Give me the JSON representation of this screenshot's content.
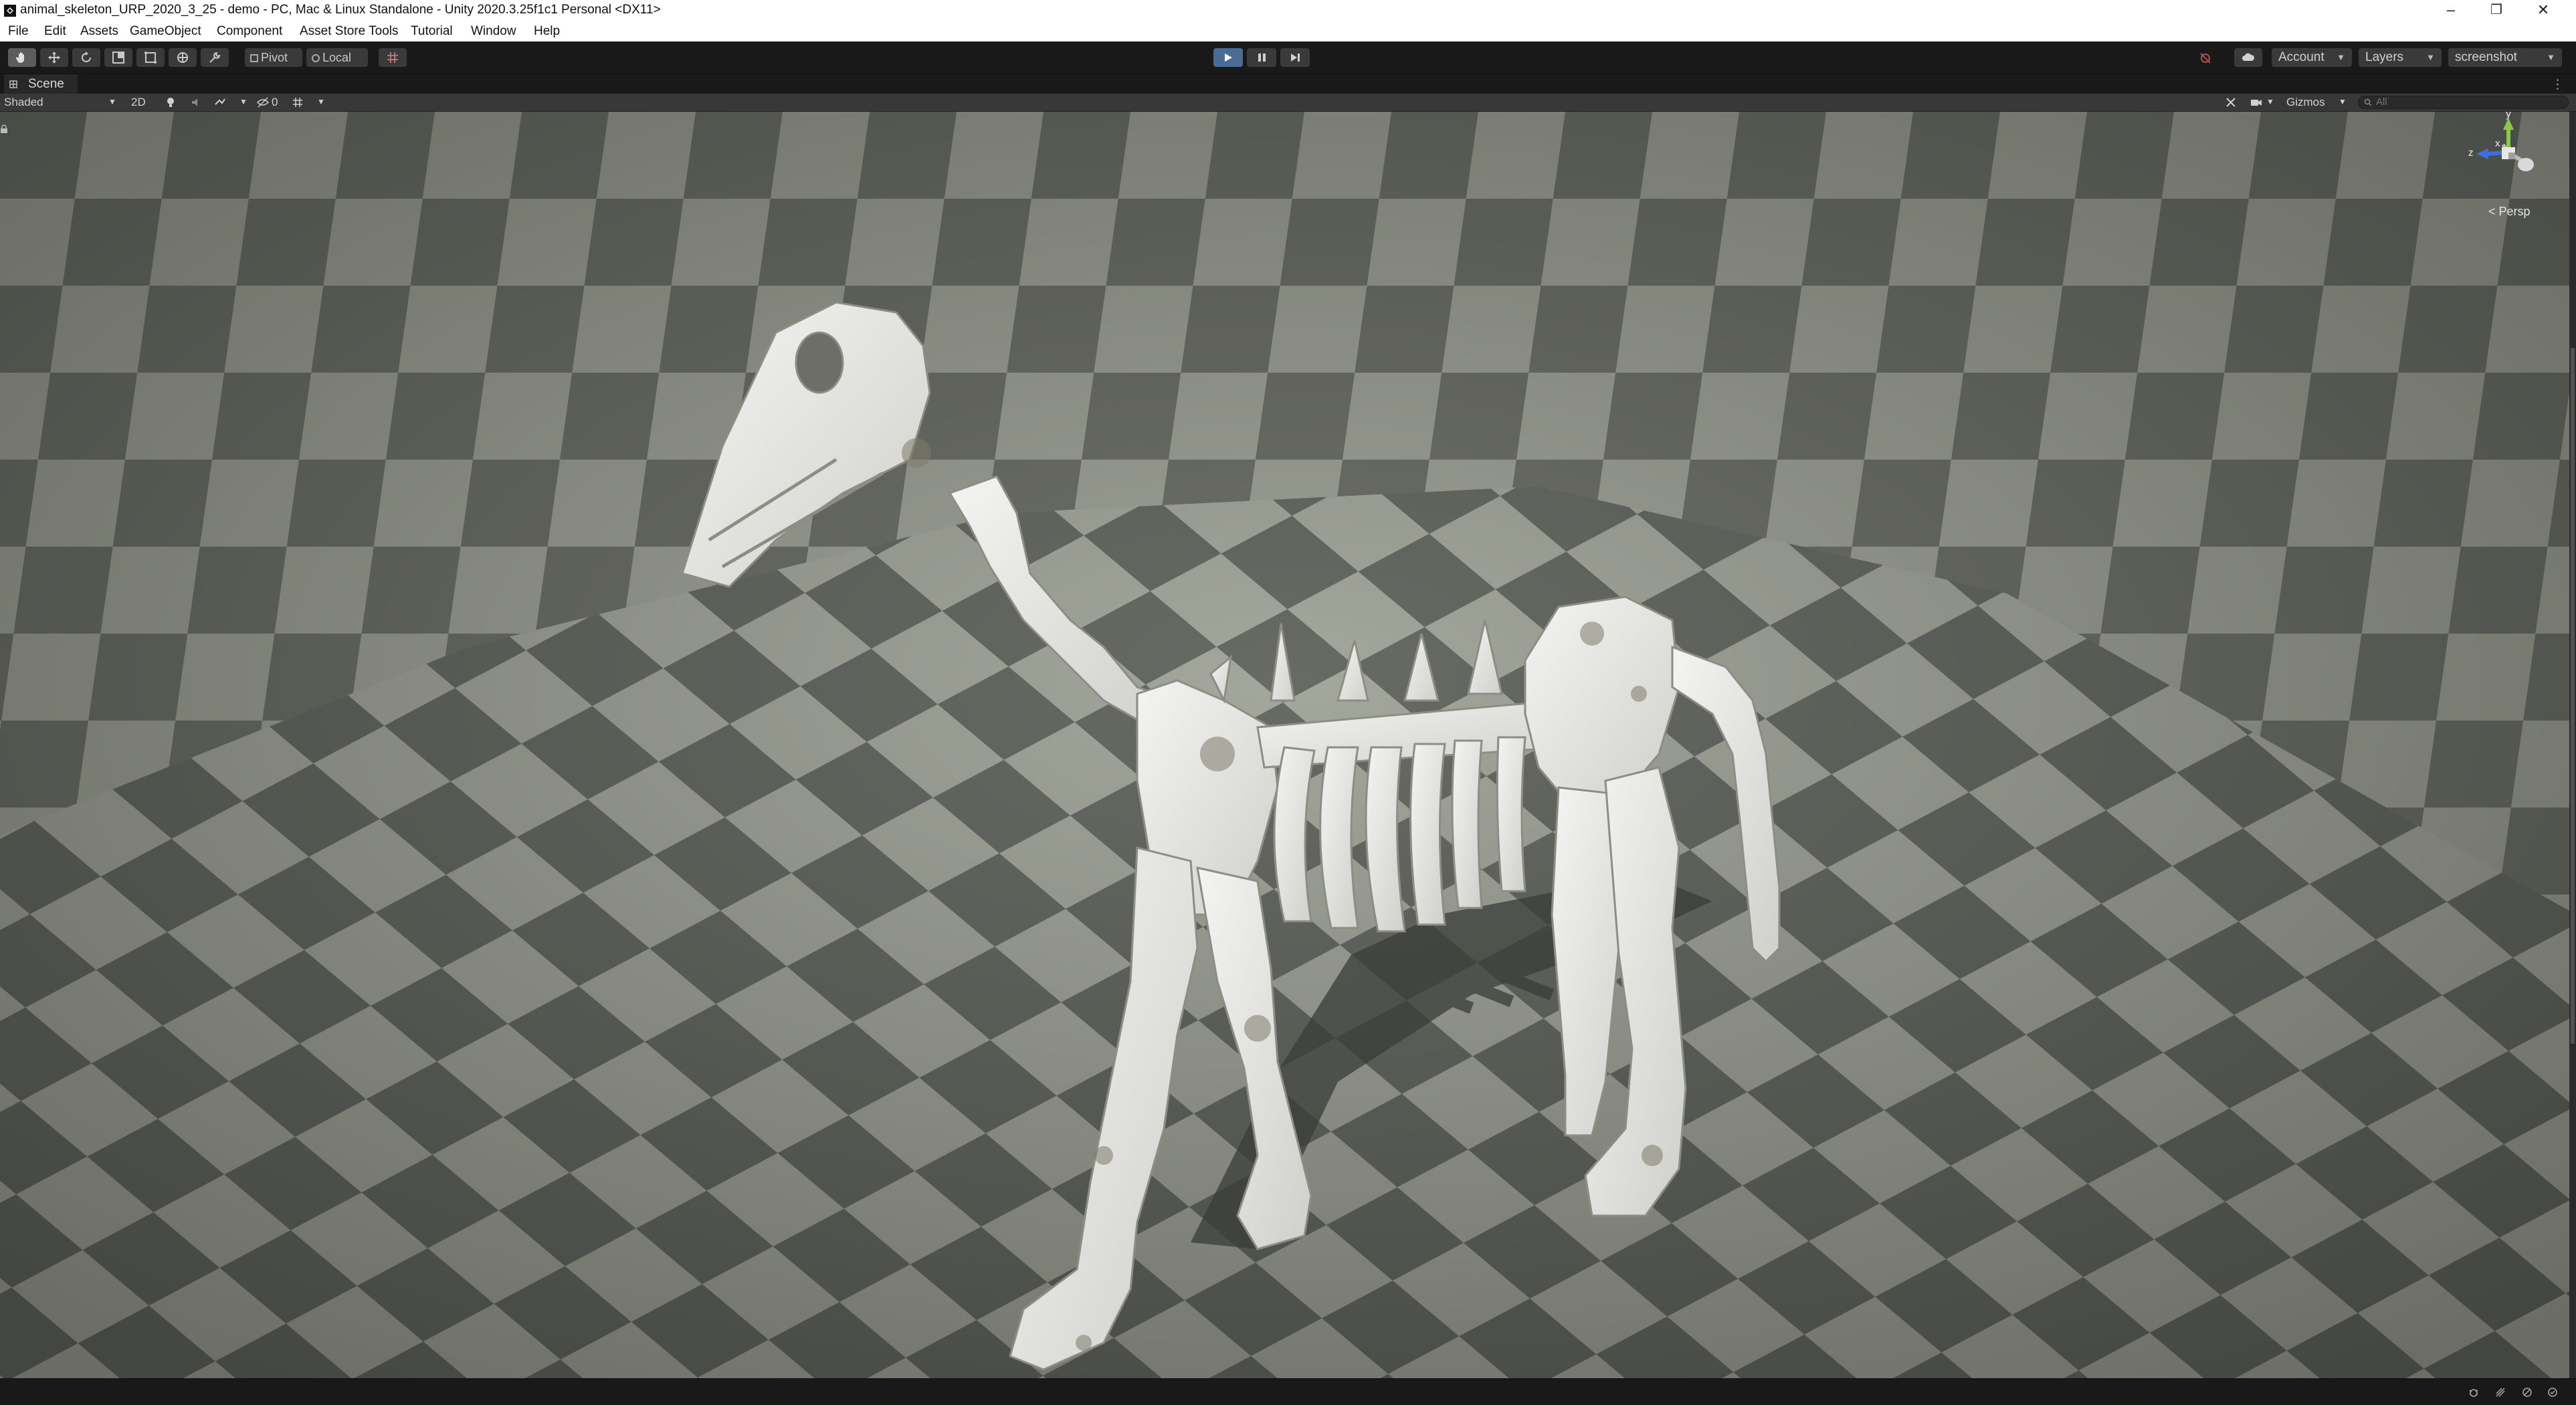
{
  "window": {
    "title": "animal_skeleton_URP_2020_3_25 - demo - PC, Mac & Linux Standalone - Unity 2020.3.25f1c1 Personal <DX11>",
    "minimize_glyph": "–",
    "restore_glyph": "❐",
    "close_glyph": "✕"
  },
  "menu": {
    "items": [
      "File",
      "Edit",
      "Assets",
      "GameObject",
      "Component",
      "Asset Store Tools",
      "Tutorial",
      "Window",
      "Help"
    ]
  },
  "toolbar": {
    "pivot_label": "Pivot",
    "local_label": "Local",
    "account_label": "Account",
    "layers_label": "Layers",
    "layout_label": "screenshot",
    "play_state": "playing"
  },
  "scene": {
    "tab_label": "Scene",
    "shading_mode": "Shaded",
    "mode_2d_label": "2D",
    "hidden_count": "0",
    "gizmos_label": "Gizmos",
    "search_placeholder": "All",
    "projection_label": "Persp",
    "axis_labels": {
      "y": "y",
      "x": "x",
      "z": "z"
    }
  },
  "colors": {
    "accent_play": "#4a6b93",
    "background_dark": "#191919",
    "panel": "#383838"
  }
}
